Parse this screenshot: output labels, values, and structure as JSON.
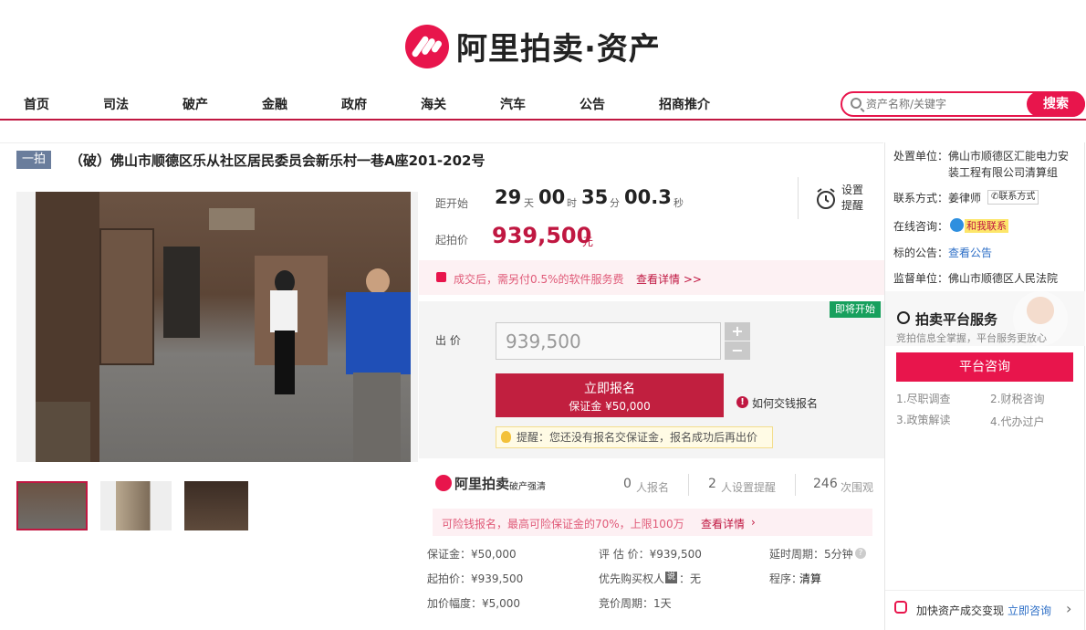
{
  "header": {
    "brand": "阿里拍卖·资产"
  },
  "nav": {
    "items": [
      "首页",
      "司法",
      "破产",
      "金融",
      "政府",
      "海关",
      "汽车",
      "公告",
      "招商推介"
    ],
    "search_placeholder": "资产名称/关键字",
    "search_button": "搜索"
  },
  "item": {
    "tag": "一拍",
    "title": "（破）佛山市顺德区乐从社区居民委员会新乐村一巷A座201-202号"
  },
  "countdown": {
    "label": "距开始",
    "days": "29",
    "days_unit": "天",
    "hours": "00",
    "hours_unit": "时",
    "minutes": "35",
    "minutes_unit": "分",
    "seconds": "00.3",
    "seconds_unit": "秒",
    "reminder_label": "设置提醒"
  },
  "start_price": {
    "label": "起拍价",
    "value": "939,500",
    "unit": "元"
  },
  "fee_notice": {
    "text": "成交后，需另付0.5%的软件服务费",
    "link": "查看详情 >>"
  },
  "bid": {
    "badge": "即将开始",
    "label": "出  价",
    "value": "939,500",
    "plus": "+",
    "minus": "−",
    "signup_label": "立即报名",
    "deposit_label": "保证金 ¥50,000",
    "howto_label": "如何交钱报名",
    "tip": "提醒：您还没有报名交保证金，报名成功后再出价"
  },
  "stats": {
    "brand": "阿里拍卖",
    "subbrand": "破产强清",
    "signups": "0",
    "signups_label": "人报名",
    "reminders": "2",
    "reminders_label": "人设置提醒",
    "views": "246",
    "views_label": "次围观"
  },
  "insurance": {
    "text": "可险钱报名，最高可险保证金的70%，上限100万",
    "link": "查看详情"
  },
  "details": {
    "deposit": "保证金：¥50,000",
    "assess": "评 估 价：¥939,500",
    "delay": "延时周期：5分钟",
    "start": "起拍价：¥939,500",
    "priority_label": "优先购买权人",
    "priority_tag": "说",
    "priority_value": "：无",
    "procedure": "程序：",
    "procedure_value": "清算",
    "increment": "加价幅度：¥5,000",
    "cycle": "竞价周期：1天"
  },
  "sidebar": {
    "dispose_label": "处置单位：",
    "dispose_value": "佛山市顺德区汇能电力安装工程有限公司清算组",
    "contact_label": "联系方式：",
    "contact_value": "姜律师",
    "contact_btn": "联系方式",
    "online_label": "在线咨询：",
    "online_btn": "和我联系",
    "notice_label": "标的公告：",
    "notice_link": "查看公告",
    "supervise_label": "监督单位：",
    "supervise_value": "佛山市顺德区人民法院",
    "service_title": "拍卖平台服务",
    "service_sub": "竞拍信息全掌握，平台服务更放心",
    "consult_btn": "平台咨询",
    "services": [
      "1.尽职调查",
      "2.财税咨询",
      "3.政策解读",
      "4.代办过户"
    ],
    "bottom_text": "加快资产成交变现",
    "bottom_link": "立即咨询"
  },
  "colors": {
    "brand": "#e8154c",
    "price": "#c01741"
  }
}
